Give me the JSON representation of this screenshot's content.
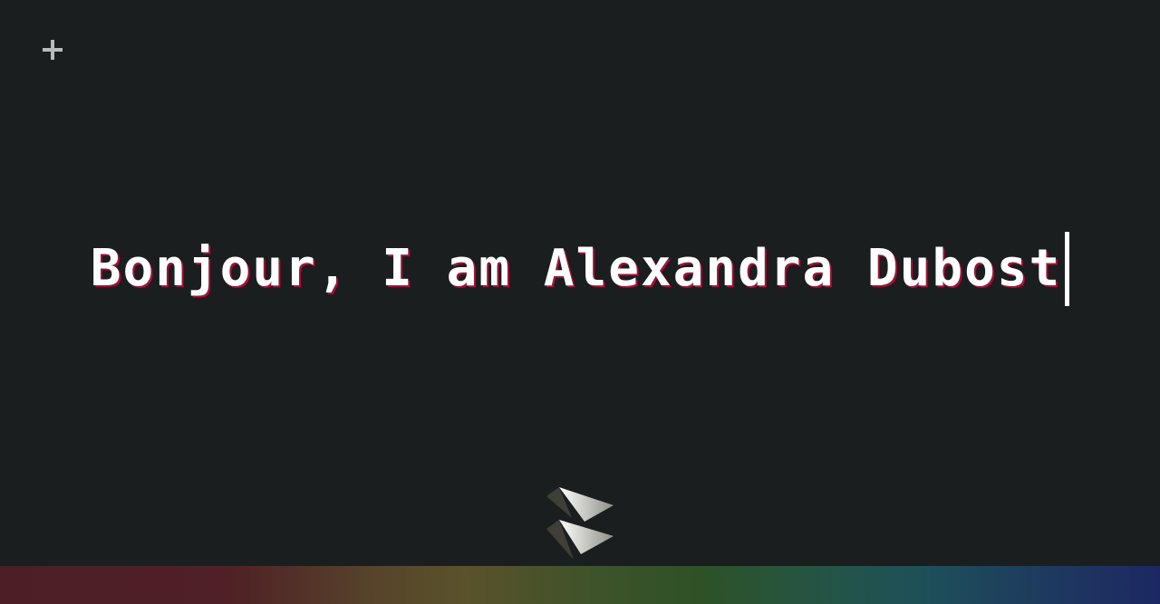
{
  "header": {
    "menu_icon": "plus-icon"
  },
  "hero": {
    "headline": "Bonjour, I am Alexandra Dubost"
  },
  "footer": {
    "scroll_icon": "double-chevron-down-icon"
  },
  "colors": {
    "background": "#1b1e1f",
    "text": "#ffffff",
    "text_shadow": "#a3123a",
    "bar_start": "#4b1f24",
    "bar_end": "#1c2863"
  }
}
